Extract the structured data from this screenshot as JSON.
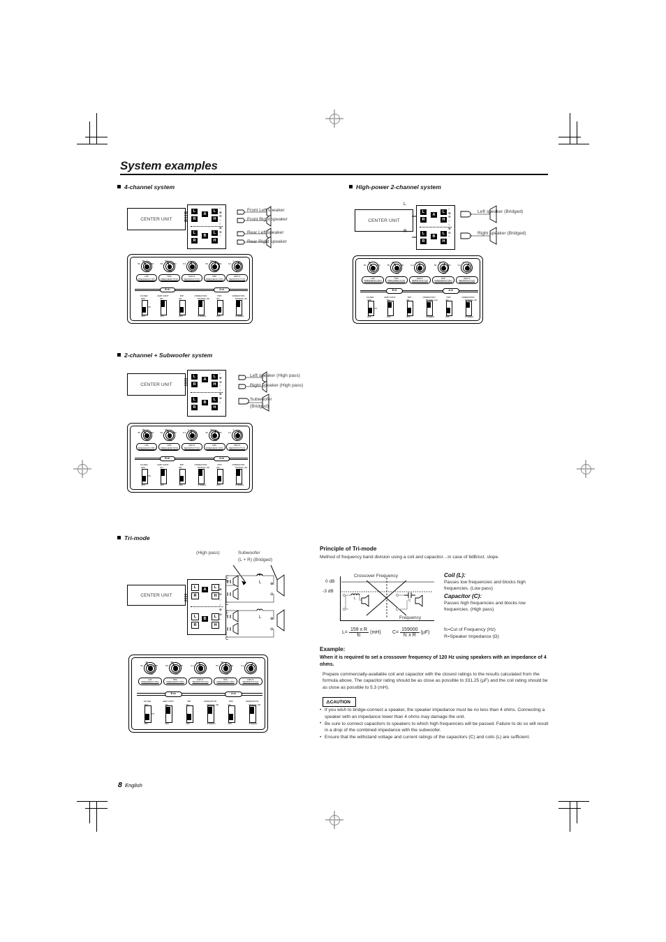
{
  "page": {
    "title": "System examples",
    "footer_number": "8",
    "footer_language": "English"
  },
  "sections": {
    "four_channel": {
      "heading": "4-channel system"
    },
    "high_power": {
      "heading": "High-power 2-channel system"
    },
    "two_channel_sub": {
      "heading": "2-channel + Subwoofer system"
    },
    "tri_mode": {
      "heading": "Tri-mode"
    }
  },
  "common": {
    "center_unit": "CENTER UNIT"
  },
  "diagram_4ch": {
    "speakers": [
      "Front Left speaker",
      "Front Right speaker",
      "Rear Left speaker",
      "Rear Right speaker"
    ],
    "terminal_rows": [
      {
        "left": "L",
        "ch": "A",
        "right": "L"
      },
      {
        "left": "R",
        "ch": "A",
        "right": "H"
      },
      {
        "left": "L",
        "ch": "B",
        "right": "L"
      },
      {
        "left": "R",
        "ch": "B",
        "right": "H"
      }
    ]
  },
  "diagram_highpower": {
    "input_labels": [
      "L",
      "R"
    ],
    "speakers": [
      "Left speaker (Bridged)",
      "Right speaker (Bridged)"
    ]
  },
  "diagram_2ch_sub": {
    "speakers": [
      "Left speaker (High pass)",
      "Right speaker (High pass)",
      "Subwoofer",
      "(Bridged)"
    ]
  },
  "diagram_trimode": {
    "callout_highpass": "(High pass)",
    "callout_sub_line1": "Subwoofer",
    "callout_sub_line2": "(L + R) (Bridged)",
    "component_coil": "L",
    "component_cap": "C",
    "polarity_plus": "⊕",
    "polarity_minus": "⊖"
  },
  "panel": {
    "knobs": [
      {
        "caption_line1": "LPF",
        "caption_line2": "FREQUENCY(Hz)",
        "scale": [
          "50",
          "80",
          "150",
          "400"
        ]
      },
      {
        "caption_line1": "HPF",
        "caption_line2": "FREQUENCY(Hz)",
        "scale": [
          "50",
          "80",
          "150",
          "400"
        ]
      },
      {
        "caption_line1": "INPUT",
        "caption_line2": "SENSITIVITY(V)",
        "scale": [
          "0.2",
          "1",
          "4",
          "5"
        ]
      },
      {
        "caption_line1": "HPF",
        "caption_line2": "FREQUENCY(Hz)",
        "scale": [
          "50",
          "80",
          "150",
          "400"
        ]
      },
      {
        "caption_line1": "INPUT",
        "caption_line2": "SENSITIVITY(V)",
        "scale": [
          "0.2",
          "1",
          "4",
          "5"
        ]
      }
    ],
    "channel_pills": [
      "B ch",
      "A ch"
    ],
    "switches": [
      {
        "title": "FILTER",
        "top": "HPF",
        "mid": "LPF",
        "bottom": "OFF"
      },
      {
        "title": "AMP CONT",
        "top": "ON",
        "bottom": "OFF"
      },
      {
        "title": "BIP",
        "top": "ON",
        "bottom": "OFF"
      },
      {
        "title": "OPERATION",
        "top": "MONO(L+R)",
        "bottom": "STEREO"
      },
      {
        "title": "HPF",
        "top": "ON",
        "bottom": "OFF"
      },
      {
        "title": "OPERATION",
        "top": "MONO(L+R)",
        "bottom": "STEREO"
      }
    ]
  },
  "principle": {
    "heading": "Principle of Tri-mode",
    "intro": "Method of frequency band division using a coil and capacitor…in case of 6dB/oct. slope.",
    "graph": {
      "label_crossover": "Crossover Frequency",
      "label_0db": "0 dB",
      "label_m3db": "-3 dB",
      "label_frequency": "Frequency",
      "coil_symbol": "L",
      "cap_symbol": "C"
    },
    "coil_heading": "Coil (L):",
    "coil_text": "Passes low frequencies and blocks high frequencies. (Low pass)",
    "cap_heading": "Capacitor (C):",
    "cap_text": "Passes high frequencies and blocks low frequencies. (High pass)",
    "formula": {
      "l_lhs": "L=",
      "l_num": "159 x R",
      "l_den": "fc",
      "l_unit": "(mH)",
      "c_lhs": "C=",
      "c_num": "159000",
      "c_den": "fc x R",
      "c_unit": "(µF)",
      "legend_fc": "fc=Cut of Frequency (Hz)",
      "legend_r": "R=Speaker Impedance (Ω)"
    },
    "example_heading": "Example:",
    "example_body": "When it is required to set a crossover frequency of 120 Hz using speakers with an impedance of 4 ohms.",
    "example_note": "Prepare commercially-available coil and capacitor with the closest ratings to the results calculated from the formula above. The capacitor rating should be as close as possible to 331.25 (µF) and the coil rating should be as close as possible to 5.3 (mH)."
  },
  "caution": {
    "label": "⚠CAUTION",
    "items": [
      "If you wish to bridge-connect a speaker, the speaker impedance must be no less than 4 ohms. Connecting a speaker with an impedance lower than 4 ohms may damage the unit.",
      "Be sure to connect capacitors to speakers to which high frequencies will be passed. Failure to do so will result in a drop of the combined impedance with the subwoofer.",
      "Ensure that the withstand voltage and current ratings of the capacitors (C) and coils (L) are sufficient."
    ]
  }
}
